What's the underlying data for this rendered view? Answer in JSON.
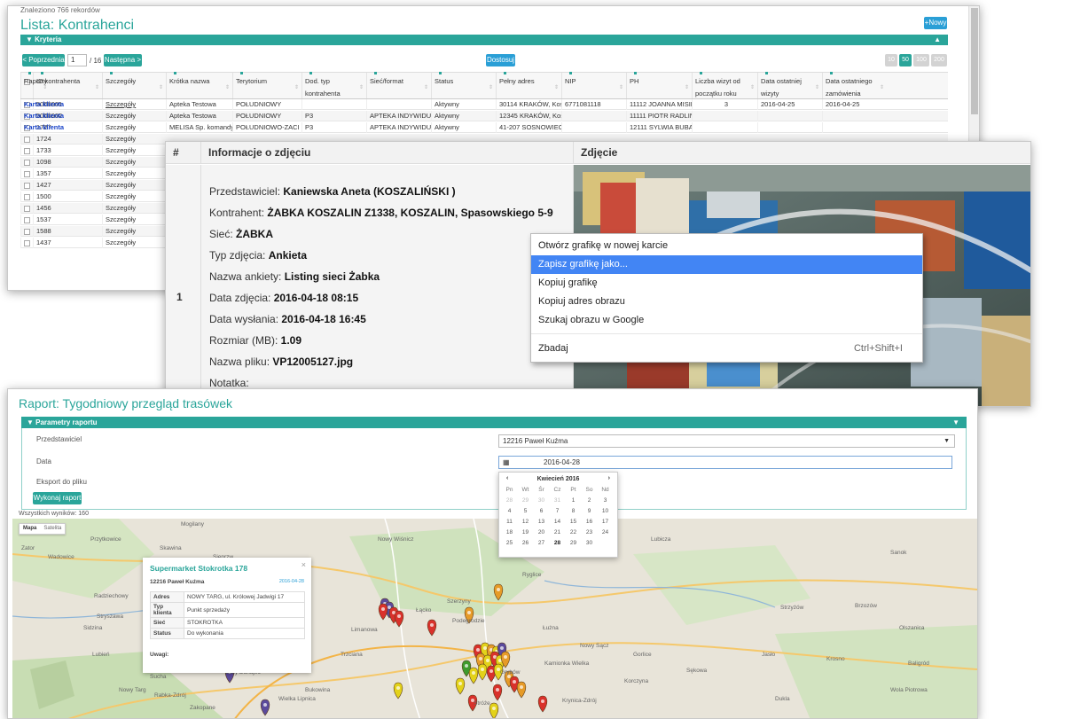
{
  "lista": {
    "found": "Znaleziono 766 rekordów",
    "title": "Lista: Kontrahenci",
    "new_btn": "+Nowy",
    "criteria": "Kryteria",
    "prev": "< Poprzednia",
    "page_input": "1",
    "page_of": "/ 16",
    "next": "Następna >",
    "dostosuj": "Dostosuj",
    "page_sizes": [
      "10",
      "50",
      "100",
      "200"
    ],
    "columns": [
      "ID kontrahenta",
      "Szczegóły",
      "Krótka nazwa",
      "Terytorium",
      "Dod. typ kontrahenta",
      "Sieć/format",
      "Status",
      "Pełny adres",
      "NIP",
      "PH",
      "Liczba wizyt od początku roku",
      "Data ostatniej wizyty",
      "Data ostatniego zamówienia",
      "Raporty"
    ],
    "rows": [
      [
        "5000001",
        "Szczegóły",
        "Apteka Testowa",
        "POŁUDNIOWY",
        "",
        "",
        "Aktywny",
        "30114 KRAKÓW, Koś",
        "6771081118",
        "11112 JOANNA MISIE",
        "3",
        "2016-04-25",
        "2016-04-25",
        "Karta klienta"
      ],
      [
        "5000002",
        "Szczegóły",
        "Apteka Testowa",
        "POŁUDNIOWY",
        "P3",
        "APTEKA INDYWIDUA",
        "Aktywny",
        "12345 KRAKÓW, Koś",
        "",
        "11111 PIOTR RADLIN",
        "",
        "",
        "",
        "Karta klienta"
      ],
      [
        "1727",
        "Szczegóły",
        "MELISA Sp. komandy",
        "POŁUDNIOWO-ZACI",
        "P3",
        "APTEKA INDYWIDUA",
        "Aktywny",
        "41-207 SOSNOWIEC",
        "",
        "12111 SYLWIA BUBA",
        "",
        "",
        "",
        "Karta klienta"
      ],
      [
        "1724",
        "Szczegóły"
      ],
      [
        "1733",
        "Szczegóły"
      ],
      [
        "1098",
        "Szczegóły"
      ],
      [
        "1357",
        "Szczegóły"
      ],
      [
        "1427",
        "Szczegóły"
      ],
      [
        "1500",
        "Szczegóły"
      ],
      [
        "1456",
        "Szczegóły"
      ],
      [
        "1537",
        "Szczegóły"
      ],
      [
        "1588",
        "Szczegóły"
      ],
      [
        "1437",
        "Szczegóły"
      ]
    ]
  },
  "zdjecie": {
    "col_hash": "#",
    "col_info": "Informacje o zdjęciu",
    "col_photo": "Zdjęcie",
    "row_no": "1",
    "info": [
      {
        "label": "Przedstawiciel: ",
        "value": "Kaniewska Aneta (KOSZALIŃSKI )"
      },
      {
        "label": "Kontrahent: ",
        "value": "ŻABKA KOSZALIN Z1338, KOSZALIN, Spasowskiego 5-9"
      },
      {
        "label": "Sieć: ",
        "value": "ŻABKA"
      },
      {
        "label": "Typ zdjęcia: ",
        "value": "Ankieta"
      },
      {
        "label": "Nazwa ankiety: ",
        "value": "Listing sieci Żabka"
      },
      {
        "label": "Data zdjęcia: ",
        "value": "2016-04-18 08:15"
      },
      {
        "label": "Data wysłania: ",
        "value": "2016-04-18 16:45"
      },
      {
        "label": "Rozmiar (MB): ",
        "value": "1.09"
      },
      {
        "label": "Nazwa pliku: ",
        "value": "VP12005127.jpg"
      },
      {
        "label": "Notatka:",
        "value": ""
      }
    ],
    "context_menu": [
      {
        "label": "Otwórz grafikę w nowej karcie",
        "shortcut": ""
      },
      {
        "label": "Zapisz grafikę jako...",
        "shortcut": ""
      },
      {
        "label": "Kopiuj grafikę",
        "shortcut": ""
      },
      {
        "label": "Kopiuj adres obrazu",
        "shortcut": ""
      },
      {
        "label": "Szukaj obrazu w Google",
        "shortcut": ""
      },
      {
        "label": "Zbadaj",
        "shortcut": "Ctrl+Shift+I"
      }
    ]
  },
  "raport": {
    "title": "Raport: Tygodniowy przegląd trasówek",
    "params_bar": "Parametry raportu",
    "label_rep": "Przedstawiciel",
    "label_date": "Data",
    "label_export": "Eksport do pliku",
    "run_btn": "Wykonaj raport",
    "rep_value": "12216 Paweł Kuźma",
    "date_value": "2016-04-28",
    "results": "Wszystkich wyników: 160",
    "calendar": {
      "month": "Kwiecień 2016",
      "days": [
        "Pn",
        "Wt",
        "Śr",
        "Cz",
        "Pt",
        "So",
        "Nd"
      ],
      "weeks": [
        [
          "28",
          "29",
          "30",
          "31",
          "1",
          "2",
          "3"
        ],
        [
          "4",
          "5",
          "6",
          "7",
          "8",
          "9",
          "10"
        ],
        [
          "11",
          "12",
          "13",
          "14",
          "15",
          "16",
          "17"
        ],
        [
          "18",
          "19",
          "20",
          "21",
          "22",
          "23",
          "24"
        ],
        [
          "25",
          "26",
          "27",
          "28",
          "29",
          "30",
          ""
        ]
      ],
      "selected": "28"
    },
    "map": {
      "types": [
        "Mapa",
        "Satelita"
      ],
      "places": [
        "Mogilany",
        "Przytkowice",
        "Wadowice",
        "Skawina",
        "Sieprzw",
        "Radziechowy",
        "Stryszawa",
        "Nowy Wiśnicz",
        "Lubicza",
        "Ryglice",
        "Szerzyny",
        "Łużna",
        "Mszana Dolna",
        "Łącko",
        "Limanowa",
        "Podegrodzie",
        "Nowy Sącz",
        "Trzciana",
        "Kamionka Wielka",
        "Grybów",
        "Krynica-Zdrój",
        "Stróże",
        "Gorlice",
        "Sękowa",
        "Krosno",
        "Jasło",
        "Dukla",
        "Wola Piotrowa",
        "Baligród",
        "Olszanica",
        "Strzyżów",
        "Brzozów",
        "Sanok",
        "Korczyna",
        "Zator",
        "Zakopane",
        "Nowy Targ",
        "Biały Dunajec",
        "Sucha",
        "Ludźmierz",
        "Lubień",
        "Wielka Lipnica",
        "Rabka-Zdrój",
        "Bukowina",
        "Zembrzyce",
        "Sidzina",
        "Pcim"
      ],
      "info_title": "Supermarket Stokrotka 178",
      "info_rep": "12216 Paweł Kuźma",
      "info_date": "2016-04-28 ",
      "info_rows": [
        {
          "k": "Adres",
          "v": "NOWY TARG, ul. Królowej Jadwigi 17"
        },
        {
          "k": "Typ klienta",
          "v": "Punkt sprzedaży"
        },
        {
          "k": "Sieć",
          "v": "STOKROTKA"
        },
        {
          "k": "Status",
          "v": "Do wykonania"
        }
      ],
      "info_notes": "Uwagi:"
    }
  },
  "colors": {
    "accent": "#2aa59a",
    "link": "#1a44c8",
    "menu_highlight": "#4285f4",
    "marker_red": "#d9312b",
    "marker_yellow": "#e3d21a",
    "marker_orange": "#e69b28",
    "marker_green": "#3e9a2d",
    "marker_purple": "#5b4a9c"
  }
}
